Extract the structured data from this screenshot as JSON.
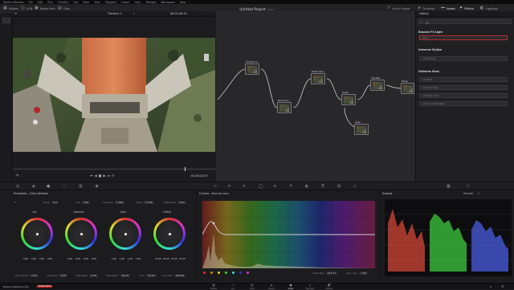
{
  "menubar": {
    "items": [
      "DaVinci Resolve",
      "File",
      "Edit",
      "Trim",
      "Timeline",
      "Clip",
      "Mark",
      "View",
      "Playback",
      "Fusion",
      "Color",
      "Fairlight",
      "Workspace",
      "Help"
    ]
  },
  "topbar": {
    "gallery": "Gallery",
    "luts": "LUTs",
    "media_pool": "Media Pool",
    "clips": "Clips",
    "project_title": "Untitled Project",
    "project_status": "Edited",
    "quick_export": "Quick Export",
    "timeline": "Timeline",
    "nodes": "Nodes",
    "effects": "Effects",
    "lightbox": "Lightbox"
  },
  "viewer": {
    "zoom": "fit",
    "timeline_name": "Timeline 1",
    "timecode_top": "00:01:00:19",
    "timecode": "01:00:14:17",
    "clip_mode": "Clip"
  },
  "nodes": [
    {
      "num": "01",
      "label": "Timeline Tr..."
    },
    {
      "num": "02",
      "label": "Remove S..."
    },
    {
      "num": "03",
      "label": "Boost Cont..."
    },
    {
      "num": "04",
      "label": "Scope"
    },
    {
      "num": "05",
      "label": "Grain"
    },
    {
      "num": "06",
      "label": "Vignette"
    },
    {
      "num": "07",
      "label": "Sharp"
    }
  ],
  "library": {
    "tab": "Library",
    "search_placeholder": "glo",
    "section1": "Resolve FX Light",
    "item1": "Glow",
    "section2": "Universe Stylize",
    "item2": "uni.Glint FX",
    "section3": "Universe Glow",
    "items3": [
      "uni.Glow",
      "uni.Light Rays",
      "uni.Edge Glow",
      "uni.Chromatic Glow"
    ]
  },
  "wheels": {
    "panel_title": "Primaries - Color Wheels",
    "temp_label": "Temp",
    "temp": "0.0",
    "tint_label": "Tint",
    "tint": "0.00",
    "contrast_label": "Contrast",
    "contrast": "1.000",
    "pivot_label": "Pivot",
    "pivot": "0.435",
    "mid_detail_label": "Mid/Detail",
    "mid_detail": "0.00",
    "wheels": [
      {
        "name": "Lift",
        "values": [
          "0.00",
          "0.00",
          "0.00",
          "0.00"
        ]
      },
      {
        "name": "Gamma",
        "values": [
          "0.00",
          "0.00",
          "0.00",
          "0.00"
        ]
      },
      {
        "name": "Gain",
        "values": [
          "1.00",
          "1.00",
          "1.00",
          "1.00"
        ]
      },
      {
        "name": "Offset",
        "values": [
          "25.00",
          "25.00",
          "25.00",
          "25.00"
        ]
      }
    ],
    "color_boost_label": "Color Boost",
    "color_boost": "0.00",
    "shadows_label": "Shadows",
    "shadows": "0.00",
    "highlights_label": "Highlights",
    "highlights": "0.00",
    "saturation_label": "Saturation",
    "saturation": "50.00",
    "hue_label": "Hue",
    "hue": "50.00",
    "lum_mix_label": "Lum Mix",
    "lum_mix": "100.00"
  },
  "curves": {
    "panel_title": "Curves - Hue Vs Lum",
    "input_hue_label": "Input Hue",
    "input_hue": "273.17",
    "lum_gain_label": "Lum Gain",
    "lum_gain": "1.00"
  },
  "scopes": {
    "panel_title": "Scopes",
    "mode": "Parade"
  },
  "bottombar": {
    "app_name": "DaVinci Resolve 18.6",
    "badge": "PUBLIC BETA",
    "pages": [
      "Media",
      "Cut",
      "Edit",
      "Fusion",
      "Color",
      "Fairlight",
      "Deliver"
    ],
    "active_page": "Color"
  }
}
